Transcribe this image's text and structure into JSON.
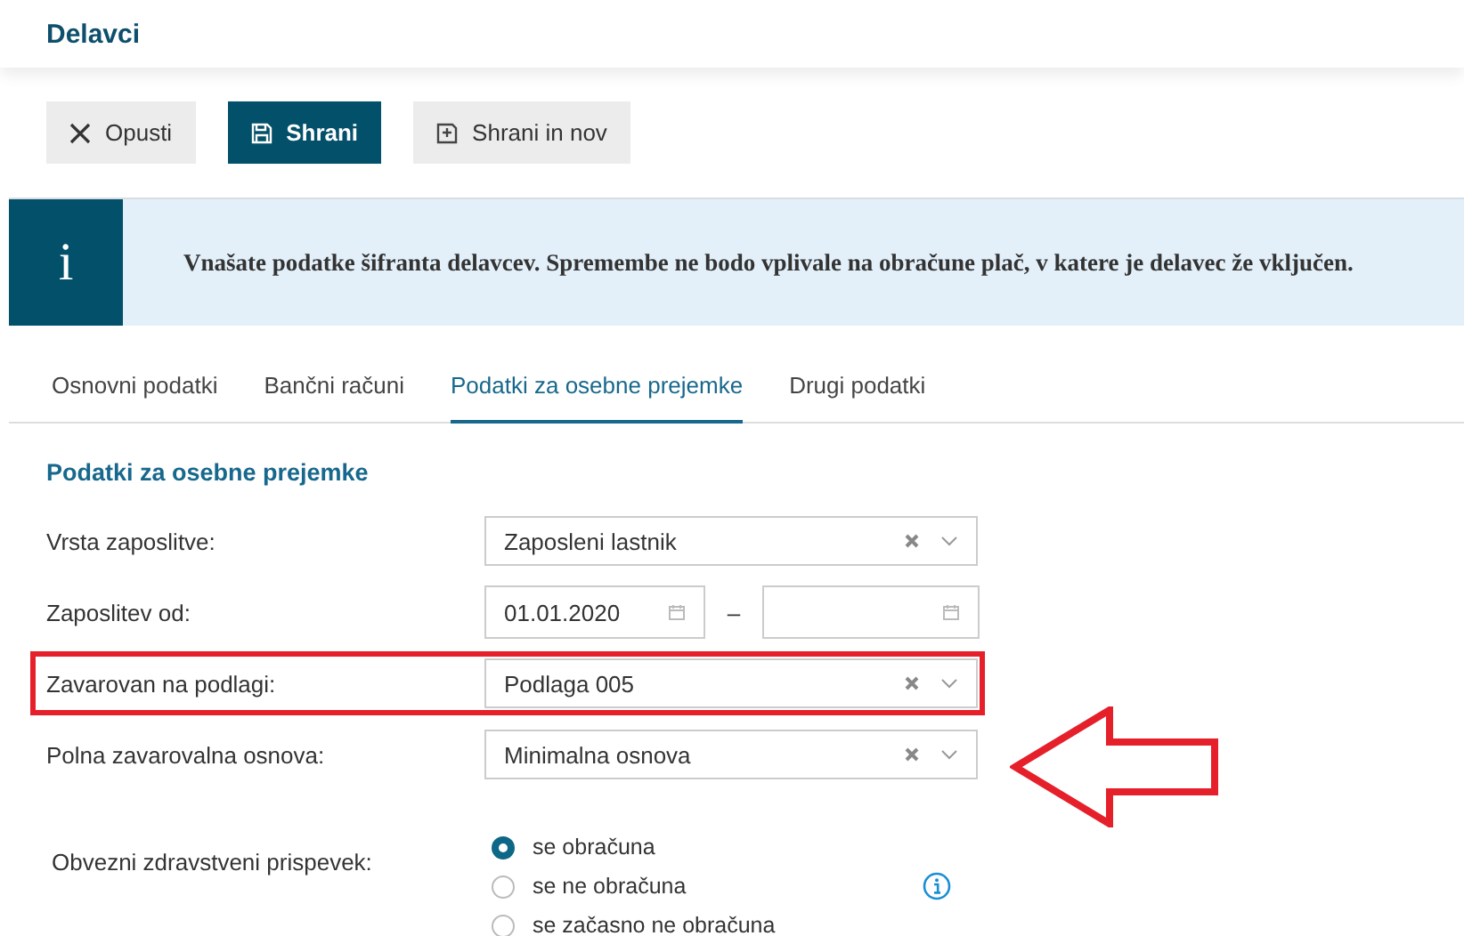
{
  "page": {
    "title": "Delavci"
  },
  "toolbar": [
    {
      "kind": "cancel",
      "label": "Opusti"
    },
    {
      "kind": "primary",
      "label": "Shrani"
    },
    {
      "kind": "save-new",
      "label": "Shrani in nov"
    }
  ],
  "info_banner": {
    "icon": "i",
    "text": "Vnašate podatke šifranta delavcev. Spremembe ne bodo vplivale na obračune plač, v katere je delavec že vključen."
  },
  "tabs": [
    {
      "label": "Osnovni podatki",
      "selected": false
    },
    {
      "label": "Bančni računi",
      "selected": false
    },
    {
      "label": "Podatki za osebne prejemke",
      "selected": true
    },
    {
      "label": "Drugi podatki",
      "selected": false
    }
  ],
  "section": {
    "title": "Podatki za osebne prejemke",
    "fields": [
      {
        "kind": "select",
        "label": "Vrsta zaposlitve:",
        "value": "Zaposleni lastnik",
        "highlighted": false,
        "pointed_at": false
      },
      {
        "kind": "daterange",
        "label": "Zaposlitev od:",
        "from": "01.01.2020",
        "separator": "–",
        "highlighted": false,
        "pointed_at": false
      },
      {
        "kind": "select",
        "label": "Zavarovan na podlagi:",
        "value": "Podlaga 005",
        "highlighted": true,
        "pointed_at": false
      },
      {
        "kind": "select",
        "label": "Polna zavarovalna osnova:",
        "value": "Minimalna osnova",
        "highlighted": false,
        "pointed_at": true
      },
      {
        "kind": "radio",
        "label": "Obvezni zdravstveni prispevek:",
        "options": [
          {
            "label": "se obračuna",
            "selected": true,
            "info": false
          },
          {
            "label": "se ne obračuna",
            "selected": false,
            "info": true
          },
          {
            "label": "se začasno ne obračuna",
            "selected": false,
            "info": false
          }
        ],
        "highlighted": false,
        "pointed_at": false
      }
    ]
  }
}
